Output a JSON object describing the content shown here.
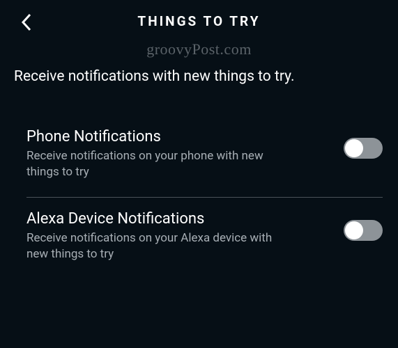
{
  "header": {
    "title": "THINGS TO TRY"
  },
  "watermark": "groovyPost.com",
  "description": "Receive notifications with new things to try.",
  "settings": [
    {
      "title": "Phone Notifications",
      "subtitle": "Receive notifications on your phone with new things to try",
      "enabled": false
    },
    {
      "title": "Alexa Device Notifications",
      "subtitle": "Receive notifications on your Alexa device with new things to try",
      "enabled": false
    }
  ]
}
